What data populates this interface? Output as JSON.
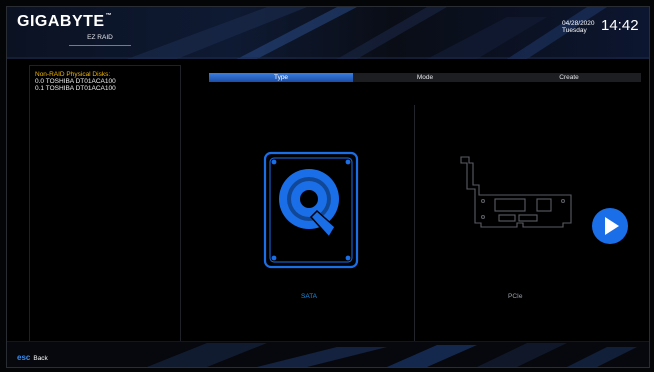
{
  "header": {
    "brand": "GIGABYTE",
    "brand_mark": "™",
    "mode_label": "EZ RAID",
    "date": "04/28/2020",
    "weekday": "Tuesday",
    "time": "14:42"
  },
  "left_panel": {
    "title": "Non-RAID Physical Disks:",
    "disks": [
      "0.0  TOSHIBA DT01ACA100",
      "0.1  TOSHIBA DT01ACA100"
    ]
  },
  "tabs": [
    {
      "label": "Type",
      "active": true
    },
    {
      "label": "Mode",
      "active": false
    },
    {
      "label": "Create",
      "active": false
    }
  ],
  "options": {
    "sata": {
      "label": "SATA",
      "icon": "hard-disk-icon"
    },
    "pcie": {
      "label": "PCIe",
      "icon": "pcie-card-icon"
    }
  },
  "next_button": {
    "icon": "play-next-icon"
  },
  "footer": {
    "key": "esc",
    "action": "Back"
  },
  "colors": {
    "accent": "#1a6fe8",
    "title": "#f2b705",
    "sata_label": "#1d8fe0"
  }
}
